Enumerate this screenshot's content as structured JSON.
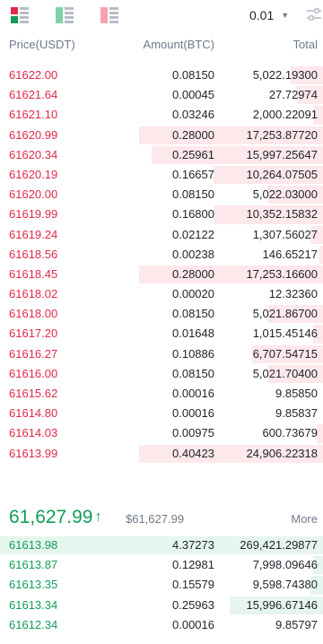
{
  "toolbar": {
    "modes": [
      {
        "icon": "order-book-both-icon"
      },
      {
        "icon": "order-book-bids-icon"
      },
      {
        "icon": "order-book-asks-icon"
      }
    ],
    "precision": "0.01",
    "colors": {
      "ask": "#e0294a",
      "bid": "#0f9d58"
    }
  },
  "header": {
    "price": "Price(USDT)",
    "amount": "Amount(BTC)",
    "total": "Total"
  },
  "asks": [
    {
      "price": "61622.00",
      "amount": "0.08150",
      "total": "5,022.19300",
      "depth": 0.1
    },
    {
      "price": "61621.64",
      "amount": "0.00045",
      "total": "27.72974",
      "depth": 0.08
    },
    {
      "price": "61621.10",
      "amount": "0.03246",
      "total": "2,000.22091",
      "depth": 0.03
    },
    {
      "price": "61620.99",
      "amount": "0.28000",
      "total": "17,253.87720",
      "depth": 0.57
    },
    {
      "price": "61620.34",
      "amount": "0.25961",
      "total": "15,997.25647",
      "depth": 0.53
    },
    {
      "price": "61620.19",
      "amount": "0.16657",
      "total": "10,264.07505",
      "depth": 0.34
    },
    {
      "price": "61620.00",
      "amount": "0.08150",
      "total": "5,022.03000",
      "depth": 0.17
    },
    {
      "price": "61619.99",
      "amount": "0.16800",
      "total": "10,352.15832",
      "depth": 0.34
    },
    {
      "price": "61619.24",
      "amount": "0.02122",
      "total": "1,307.56027",
      "depth": 0.04
    },
    {
      "price": "61618.56",
      "amount": "0.00238",
      "total": "146.65217",
      "depth": 0.01
    },
    {
      "price": "61618.45",
      "amount": "0.28000",
      "total": "17,253.16600",
      "depth": 0.57
    },
    {
      "price": "61618.02",
      "amount": "0.00020",
      "total": "12.32360",
      "depth": 0.0
    },
    {
      "price": "61618.00",
      "amount": "0.08150",
      "total": "5,021.86700",
      "depth": 0.17
    },
    {
      "price": "61617.20",
      "amount": "0.01648",
      "total": "1,015.45146",
      "depth": 0.03
    },
    {
      "price": "61616.27",
      "amount": "0.10886",
      "total": "6,707.54715",
      "depth": 0.22
    },
    {
      "price": "61616.00",
      "amount": "0.08150",
      "total": "5,021.70400",
      "depth": 0.17
    },
    {
      "price": "61615.62",
      "amount": "0.00016",
      "total": "9.85850",
      "depth": 0.0
    },
    {
      "price": "61614.80",
      "amount": "0.00016",
      "total": "9.85837",
      "depth": 0.0
    },
    {
      "price": "61614.03",
      "amount": "0.00975",
      "total": "600.73679",
      "depth": 0.02
    },
    {
      "price": "61613.99",
      "amount": "0.40423",
      "total": "24,906.22318",
      "depth": 0.57
    }
  ],
  "mid": {
    "last_price": "61,627.99",
    "arrow": "↑",
    "mark_price": "$61,627.99",
    "more": "More"
  },
  "bids": [
    {
      "price": "61613.98",
      "amount": "4.37273",
      "total": "269,421.29877",
      "depth": 1.0
    },
    {
      "price": "61613.87",
      "amount": "0.12981",
      "total": "7,998.09646",
      "depth": 0.03
    },
    {
      "price": "61613.35",
      "amount": "0.15579",
      "total": "9,598.74380",
      "depth": 0.04
    },
    {
      "price": "61613.34",
      "amount": "0.25963",
      "total": "15,996.67146",
      "depth": 0.29
    },
    {
      "price": "61612.34",
      "amount": "0.00016",
      "total": "9.85797",
      "depth": 0.0
    }
  ]
}
